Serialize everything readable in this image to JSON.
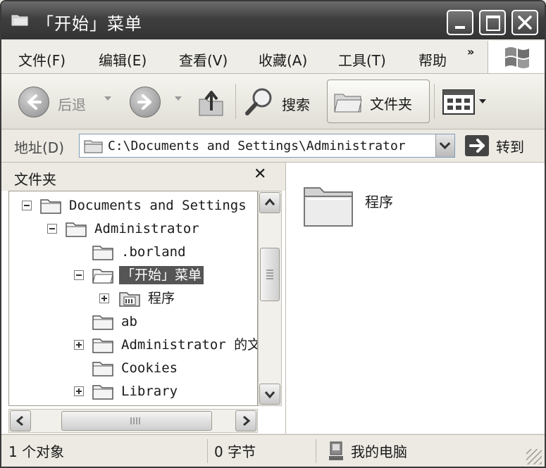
{
  "window": {
    "title": "「开始」菜单"
  },
  "menu": [
    {
      "label": "文件(F)"
    },
    {
      "label": "编辑(E)"
    },
    {
      "label": "查看(V)"
    },
    {
      "label": "收藏(A)"
    },
    {
      "label": "工具(T)"
    },
    {
      "label": "帮助"
    }
  ],
  "menu_more": "»",
  "toolbar": {
    "back_label": "后退",
    "search_label": "搜索",
    "folders_label": "文件夹"
  },
  "address": {
    "label": "地址(D)",
    "value": "C:\\Documents and Settings\\Administrator",
    "go_label": "转到"
  },
  "folder_pane": {
    "title": "文件夹",
    "close": "✕"
  },
  "tree": [
    {
      "label": "Documents and Settings",
      "expander": "minus"
    },
    {
      "label": "Administrator",
      "expander": "minus"
    },
    {
      "label": ".borland",
      "expander": "none"
    },
    {
      "label": "「开始」菜单",
      "expander": "minus",
      "selected": true
    },
    {
      "label": "程序",
      "expander": "plus"
    },
    {
      "label": "ab",
      "expander": "none"
    },
    {
      "label": "Administrator 的文",
      "expander": "plus"
    },
    {
      "label": "Cookies",
      "expander": "none"
    },
    {
      "label": "Library",
      "expander": "plus"
    }
  ],
  "content": {
    "items": [
      {
        "label": "程序"
      }
    ]
  },
  "status": {
    "objects": "1 个对象",
    "size": "0 字节",
    "location": "我的电脑"
  },
  "colors": {
    "titlebar": "#4a4a4a",
    "selection": "#555555"
  }
}
